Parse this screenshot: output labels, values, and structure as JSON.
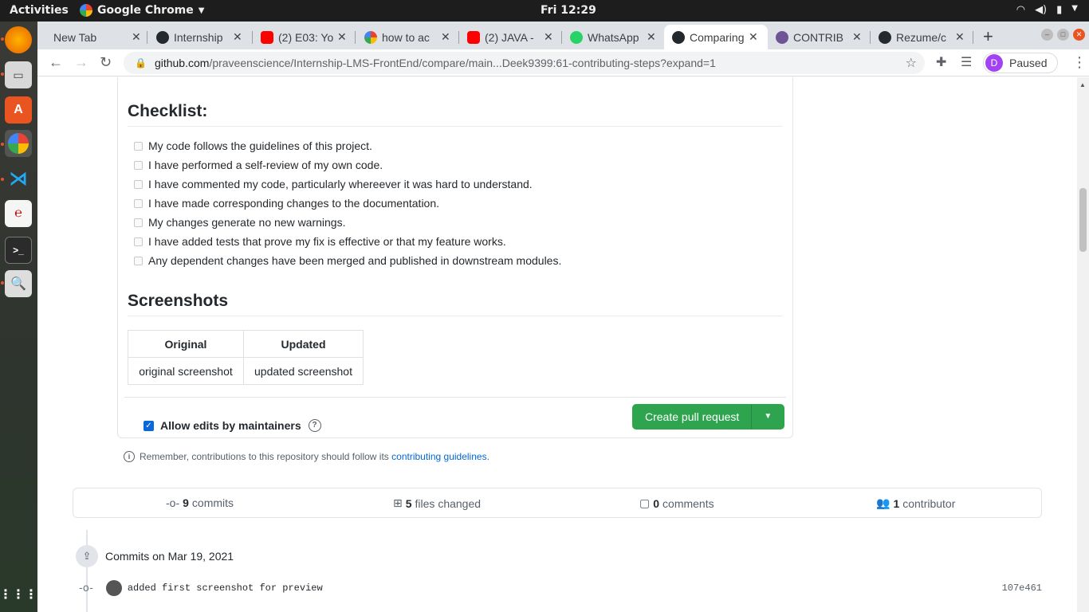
{
  "os": {
    "activities": "Activities",
    "app_name": "Google Chrome",
    "clock": "Fri 12:29"
  },
  "tabs": [
    {
      "label": "New Tab",
      "favicon": "none"
    },
    {
      "label": "Internship",
      "favicon": "github-icon"
    },
    {
      "label": "(2) E03: Yo",
      "favicon": "youtube-icon"
    },
    {
      "label": "how to ac",
      "favicon": "google-icon"
    },
    {
      "label": "(2) JAVA -",
      "favicon": "youtube-icon"
    },
    {
      "label": "WhatsApp",
      "favicon": "whatsapp-icon"
    },
    {
      "label": "Comparing",
      "favicon": "github-icon",
      "active": true
    },
    {
      "label": "CONTRIB",
      "favicon": "octocat-icon"
    },
    {
      "label": "Rezume/c",
      "favicon": "github-icon"
    }
  ],
  "address_bar": {
    "host": "github.com",
    "path": "/praveenscience/Internship-LMS-FrontEnd/compare/main...Deek9399:61-contributing-steps?expand=1"
  },
  "profile": {
    "initial": "D",
    "label": "Paused"
  },
  "checklist": {
    "heading": "Checklist:",
    "items": [
      "My code follows the guidelines of this project.",
      "I have performed a self-review of my own code.",
      "I have commented my code, particularly whereever it was hard to understand.",
      "I have made corresponding changes to the documentation.",
      "My changes generate no new warnings.",
      "I have added tests that prove my fix is effective or that my feature works.",
      "Any dependent changes have been merged and published in downstream modules."
    ]
  },
  "screenshots": {
    "heading": "Screenshots",
    "headers": [
      "Original",
      "Updated"
    ],
    "row": [
      "original screenshot",
      "updated screenshot"
    ]
  },
  "footer": {
    "allow_edits": "Allow edits by maintainers",
    "create_pr": "Create pull request",
    "remember_text": "Remember, contributions to this repository should follow its",
    "remember_link": "contributing guidelines",
    "remember_end": "."
  },
  "stats": {
    "commits_count": "9",
    "commits_label": "commits",
    "files_count": "5",
    "files_label": "files changed",
    "comments_count": "0",
    "comments_label": "comments",
    "contributors_count": "1",
    "contributors_label": "contributor"
  },
  "timeline": {
    "date_label": "Commits on Mar 19, 2021",
    "commit_message": "added first screenshot for preview",
    "commit_sha": "107e461"
  },
  "colors": {
    "primary_button": "#2ea44f",
    "link": "#0366d6",
    "chrome_tabstrip": "#dee1e6"
  }
}
